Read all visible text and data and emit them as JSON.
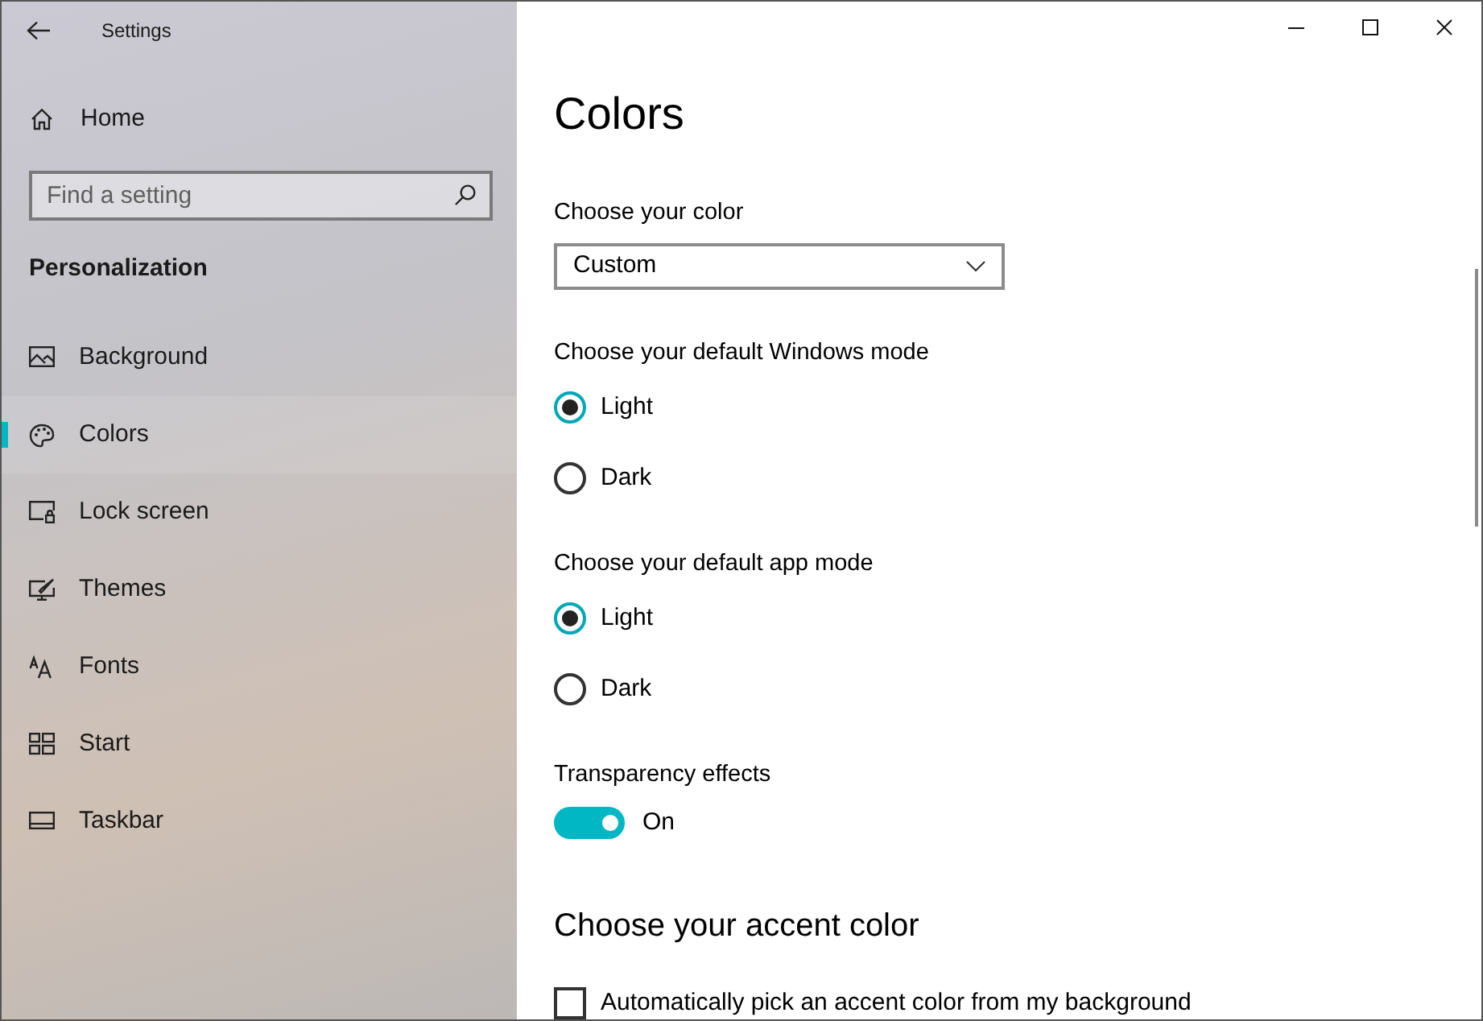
{
  "window": {
    "title": "Settings"
  },
  "sidebar": {
    "home": "Home",
    "search": {
      "placeholder": "Find a setting"
    },
    "section": "Personalization",
    "items": [
      {
        "label": "Background",
        "selected": false
      },
      {
        "label": "Colors",
        "selected": true
      },
      {
        "label": "Lock screen",
        "selected": false
      },
      {
        "label": "Themes",
        "selected": false
      },
      {
        "label": "Fonts",
        "selected": false
      },
      {
        "label": "Start",
        "selected": false
      },
      {
        "label": "Taskbar",
        "selected": false
      }
    ]
  },
  "content": {
    "title": "Colors",
    "color_choice": {
      "label": "Choose your color",
      "value": "Custom"
    },
    "modes": [
      {
        "label": "Choose your default Windows mode",
        "options": [
          {
            "label": "Light",
            "selected": true
          },
          {
            "label": "Dark",
            "selected": false
          }
        ]
      },
      {
        "label": "Choose your default app mode",
        "options": [
          {
            "label": "Light",
            "selected": true
          },
          {
            "label": "Dark",
            "selected": false
          }
        ]
      }
    ],
    "transparency": {
      "label": "Transparency effects",
      "on": true,
      "state_text": "On"
    },
    "accent": {
      "heading": "Choose your accent color",
      "checkbox": {
        "label": "Automatically pick an accent color from my background",
        "checked": false
      }
    }
  }
}
